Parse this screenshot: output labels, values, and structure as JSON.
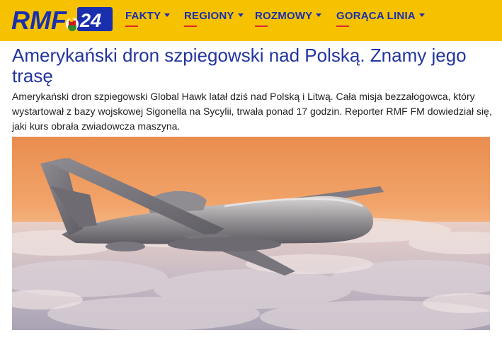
{
  "header": {
    "logo_text": "RMF24",
    "nav": [
      {
        "label": "FAKTY"
      },
      {
        "label": "REGIONY"
      },
      {
        "label": "ROZMOWY"
      },
      {
        "label": "GORĄCA LINIA"
      }
    ]
  },
  "article": {
    "title": "Amerykański dron szpiegowski nad Polską. Znamy jego trasę",
    "lead": "Amerykański dron szpiegowski Global Hawk latał dziś nad Polską i Litwą. Cała misja bezzałogowca, który wystartował z bazy wojskowej Sigonella na Sycylii, trwała ponad 17 godzin. Reporter RMF FM dowiedział się, jaki kurs obrała zwiadowcza maszyna."
  },
  "colors": {
    "header_bg": "#f6c200",
    "nav_text": "#1a2fae",
    "title_text": "#22359e",
    "accent_red": "#e0262f"
  },
  "icons": [
    "chevron-down-icon"
  ]
}
